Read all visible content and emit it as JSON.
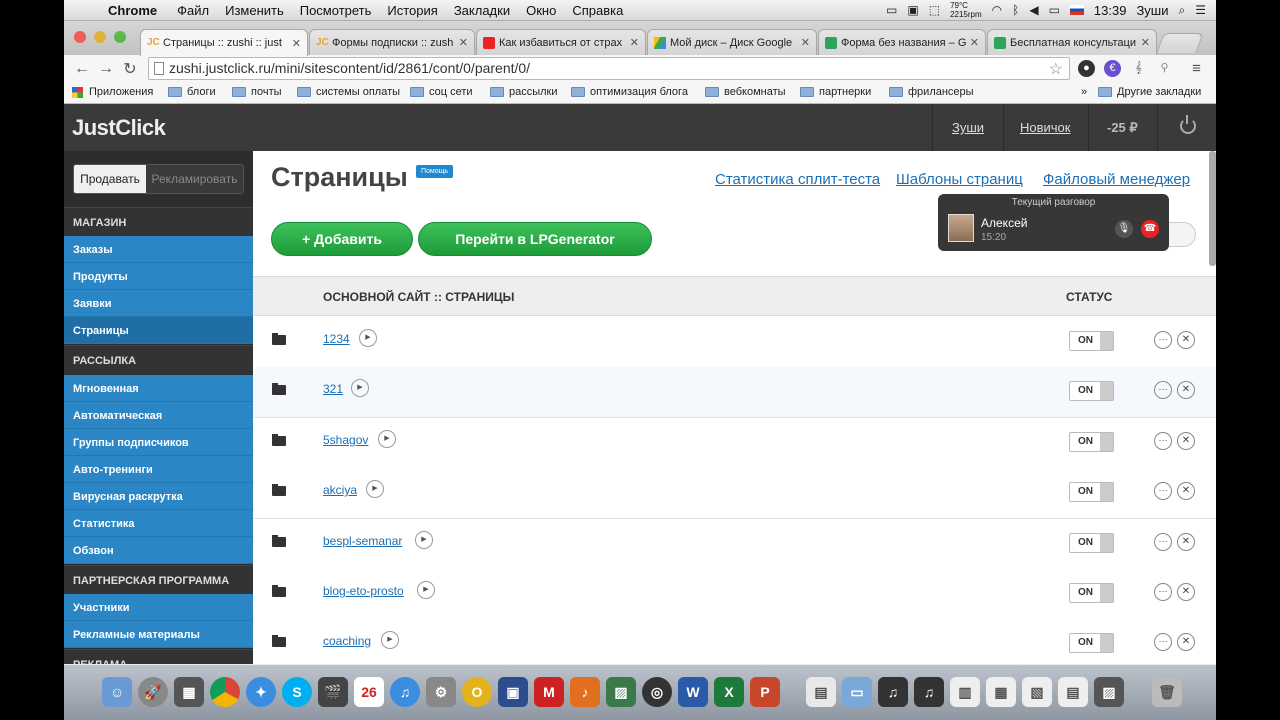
{
  "menubar": {
    "app": "Chrome",
    "items": [
      "Файл",
      "Изменить",
      "Посмотреть",
      "История",
      "Закладки",
      "Окно",
      "Справка"
    ],
    "temp": "79°C",
    "rpm": "2215rpm",
    "time": "13:39",
    "user": "Зуши"
  },
  "tabs": [
    {
      "title": "Страницы :: zushi :: just",
      "icon": "JC"
    },
    {
      "title": "Формы подписки :: zush",
      "icon": "JC"
    },
    {
      "title": "Как избавиться от страх",
      "icon": "youtube"
    },
    {
      "title": "Мой диск – Диск Google",
      "icon": "drive"
    },
    {
      "title": "Форма без названия – Go",
      "icon": "forms"
    },
    {
      "title": "Бесплатная консультаци",
      "icon": "forms"
    }
  ],
  "address": "zushi.justclick.ru/mini/sitescontent/id/2861/cont/0/parent/0/",
  "bookmarks": {
    "apps": "Приложения",
    "folders": [
      "блоги",
      "почты",
      "системы оплаты",
      "соц сети",
      "рассылки",
      "оптимизация блога",
      "вебкомнаты",
      "партнерки",
      "фрилансеры"
    ],
    "other": "Другие закладки"
  },
  "header": {
    "logo": "JustClick",
    "user": "Зуши",
    "level": "Новичок",
    "balance": "-25 ₽"
  },
  "sidebar": {
    "seg_active": "Продавать",
    "seg_inactive": "Рекламировать",
    "sections": [
      {
        "title": "МАГАЗИН",
        "items": [
          "Заказы",
          "Продукты",
          "Заявки",
          "Страницы"
        ]
      },
      {
        "title": "РАССЫЛКА",
        "items": [
          "Мгновенная",
          "Автоматическая",
          "Группы подписчиков",
          "Авто-тренинги",
          "Вирусная раскрутка",
          "Статистика",
          "Обзвон"
        ]
      },
      {
        "title": "ПАРТНЕРСКАЯ ПРОГРАММА",
        "items": [
          "Участники",
          "Рекламные материалы"
        ]
      },
      {
        "title": "РЕКЛАМА",
        "items": []
      }
    ],
    "active": "Страницы"
  },
  "main": {
    "title": "Страницы",
    "help": "Помощь",
    "links": [
      "Статистика сплит-теста",
      "Шаблоны страниц",
      "Файловый менеджер"
    ],
    "add_button": "+ Добавить",
    "lp_button": "Перейти в LPGenerator",
    "table_header": "ОСНОВНОЙ САЙТ :: СТРАНИЦЫ",
    "status_header": "СТАТУС",
    "rows": [
      {
        "name": "1234",
        "status": "ON"
      },
      {
        "name": "321",
        "status": "ON"
      },
      {
        "name": "5shagov",
        "status": "ON"
      },
      {
        "name": "akciya",
        "status": "ON"
      },
      {
        "name": "bespl-semanar",
        "status": "ON"
      },
      {
        "name": "blog-eto-prosto",
        "status": "ON"
      },
      {
        "name": "coaching",
        "status": "ON"
      }
    ]
  },
  "call": {
    "title": "Текущий разговор",
    "name": "Алексей",
    "time": "15:20"
  }
}
